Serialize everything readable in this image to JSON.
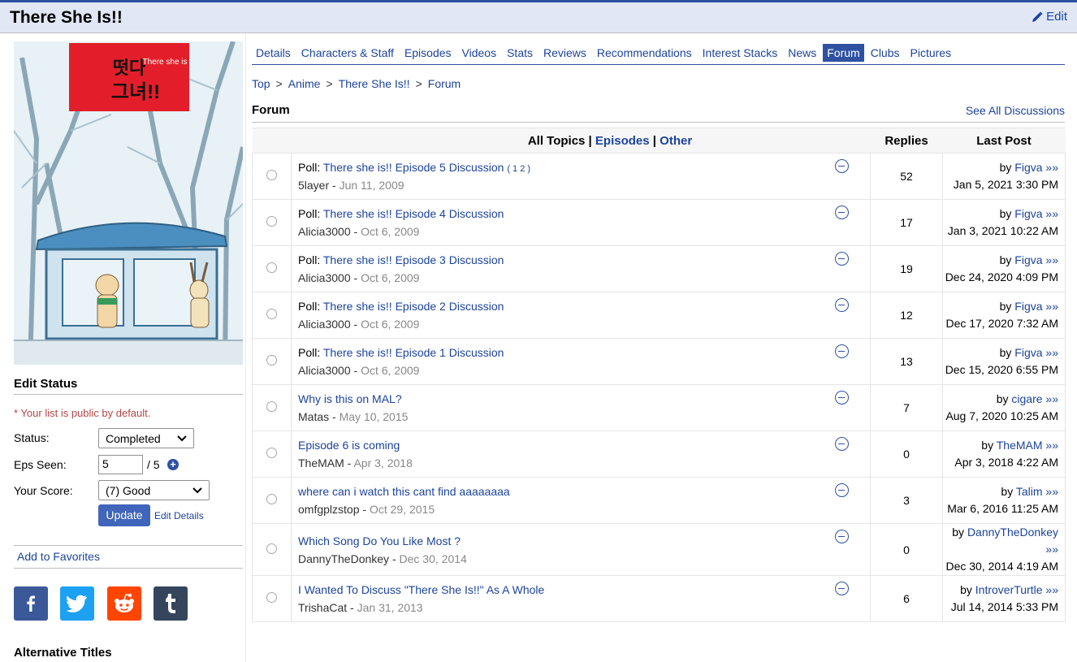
{
  "header": {
    "title": "There She Is!!",
    "edit_label": "Edit"
  },
  "sidebar": {
    "edit_status_heading": "Edit Status",
    "public_note": "* Your list is public by default.",
    "status_label": "Status:",
    "status_value": "Completed",
    "eps_label": "Eps Seen:",
    "eps_value": "5",
    "eps_total": "/ 5",
    "score_label": "Your Score:",
    "score_value": "(7) Good",
    "update_label": "Update",
    "edit_details_label": "Edit Details",
    "add_favorites_label": "Add to Favorites",
    "alt_titles_heading": "Alternative Titles",
    "poster_text": "There she is"
  },
  "nav": {
    "tabs": [
      "Details",
      "Characters & Staff",
      "Episodes",
      "Videos",
      "Stats",
      "Reviews",
      "Recommendations",
      "Interest Stacks",
      "News",
      "Forum",
      "Clubs",
      "Pictures"
    ],
    "active": "Forum"
  },
  "breadcrumb": {
    "top": "Top",
    "anime": "Anime",
    "title": "There She Is!!",
    "current": "Forum"
  },
  "forum": {
    "heading": "Forum",
    "see_all": "See All Discussions",
    "filter_all": "All Topics",
    "filter_episodes": "Episodes",
    "filter_other": "Other",
    "col_replies": "Replies",
    "col_last_post": "Last Post",
    "topics": [
      {
        "prefix": "Poll: ",
        "title": "There she is!! Episode 5 Discussion",
        "pages": "( 1 2 )",
        "author": "5layer",
        "date": "Jun 11, 2009",
        "replies": "52",
        "last_by": "Figva",
        "last_date": "Jan 5, 2021 3:30 PM"
      },
      {
        "prefix": "Poll: ",
        "title": "There she is!! Episode 4 Discussion",
        "pages": "",
        "author": "Alicia3000",
        "date": "Oct 6, 2009",
        "replies": "17",
        "last_by": "Figva",
        "last_date": "Jan 3, 2021 10:22 AM"
      },
      {
        "prefix": "Poll: ",
        "title": "There she is!! Episode 3 Discussion",
        "pages": "",
        "author": "Alicia3000",
        "date": "Oct 6, 2009",
        "replies": "19",
        "last_by": "Figva",
        "last_date": "Dec 24, 2020 4:09 PM"
      },
      {
        "prefix": "Poll: ",
        "title": "There she is!! Episode 2 Discussion",
        "pages": "",
        "author": "Alicia3000",
        "date": "Oct 6, 2009",
        "replies": "12",
        "last_by": "Figva",
        "last_date": "Dec 17, 2020 7:32 AM"
      },
      {
        "prefix": "Poll: ",
        "title": "There she is!! Episode 1 Discussion",
        "pages": "",
        "author": "Alicia3000",
        "date": "Oct 6, 2009",
        "replies": "13",
        "last_by": "Figva",
        "last_date": "Dec 15, 2020 6:55 PM"
      },
      {
        "prefix": "",
        "title": "Why is this on MAL?",
        "pages": "",
        "author": "Matas",
        "date": "May 10, 2015",
        "replies": "7",
        "last_by": "cigare",
        "last_date": "Aug 7, 2020 10:25 AM"
      },
      {
        "prefix": "",
        "title": "Episode 6 is coming",
        "pages": "",
        "author": "TheMAM",
        "date": "Apr 3, 2018",
        "replies": "0",
        "last_by": "TheMAM",
        "last_date": "Apr 3, 2018 4:22 AM"
      },
      {
        "prefix": "",
        "title": "where can i watch this cant find aaaaaaaa",
        "pages": "",
        "author": "omfgplzstop",
        "date": "Oct 29, 2015",
        "replies": "3",
        "last_by": "Talim",
        "last_date": "Mar 6, 2016 11:25 AM"
      },
      {
        "prefix": "",
        "title": "Which Song Do You Like Most ?",
        "pages": "",
        "author": "DannyTheDonkey",
        "date": "Dec 30, 2014",
        "replies": "0",
        "last_by": "DannyTheDonkey",
        "last_date": "Dec 30, 2014 4:19 AM"
      },
      {
        "prefix": "",
        "title": "I Wanted To Discuss \"There She Is!!\" As A Whole",
        "pages": "",
        "author": "TrishaCat",
        "date": "Jan 31, 2013",
        "replies": "6",
        "last_by": "IntroverTurtle",
        "last_date": "Jul 14, 2014 5:33 PM"
      }
    ]
  },
  "social": [
    {
      "name": "facebook-icon",
      "glyph": "f",
      "color": "#3b5998"
    },
    {
      "name": "twitter-icon",
      "glyph": "t",
      "color": "#1da1f2"
    },
    {
      "name": "reddit-icon",
      "glyph": "r",
      "color": "#ff4500"
    },
    {
      "name": "tumblr-icon",
      "glyph": "t",
      "color": "#35465c"
    }
  ],
  "colors": {
    "accent": "#2e51a2",
    "link": "#1c439b",
    "title_bg": "#e1e7f5",
    "button": "#4065ba"
  }
}
